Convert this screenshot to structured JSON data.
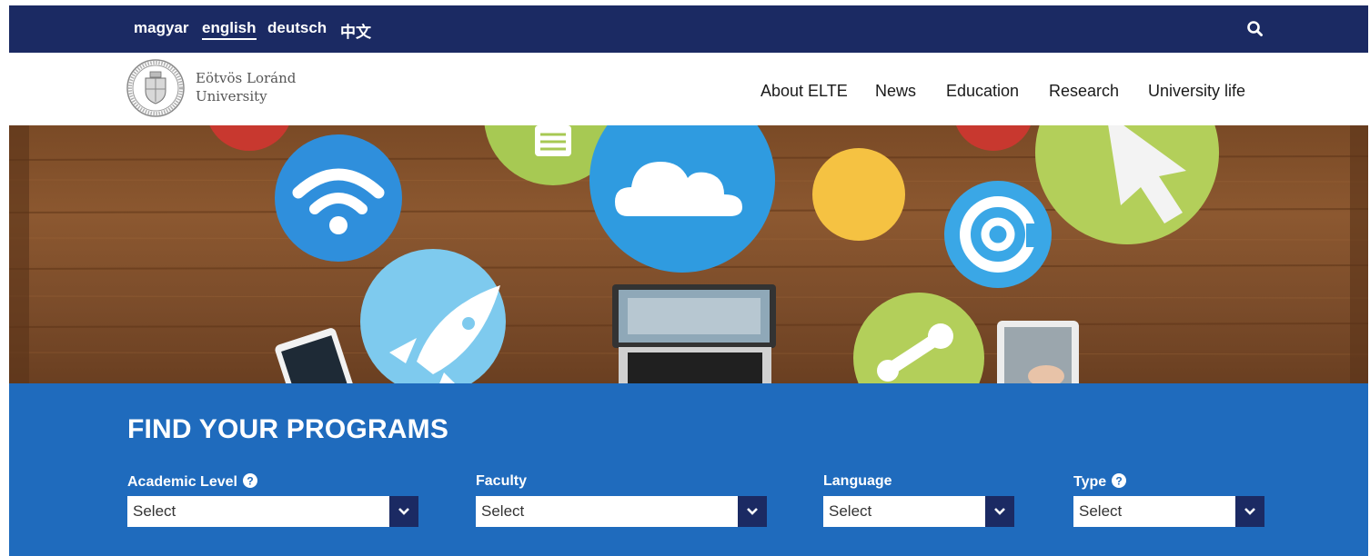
{
  "languages": [
    {
      "label": "magyar",
      "active": false
    },
    {
      "label": "english",
      "active": true
    },
    {
      "label": "deutsch",
      "active": false
    },
    {
      "label": "中文",
      "active": false
    }
  ],
  "search": {
    "icon": "search-icon"
  },
  "logo": {
    "line1": "Eötvös Loránd",
    "line2": "University"
  },
  "nav": [
    "About ELTE",
    "News",
    "Education",
    "Research",
    "University life"
  ],
  "hero": {
    "icons": [
      "wifi-icon",
      "document-icon",
      "cloud-icon",
      "at-sign-icon",
      "cursor-arrow-icon",
      "rocket-icon",
      "bone-icon"
    ]
  },
  "finder": {
    "title": "FIND YOUR PROGRAMS",
    "fields": [
      {
        "label": "Academic Level",
        "value": "Select",
        "help": true
      },
      {
        "label": "Faculty",
        "value": "Select",
        "help": false
      },
      {
        "label": "Language",
        "value": "Select",
        "help": false
      },
      {
        "label": "Type",
        "value": "Select",
        "help": true
      }
    ]
  },
  "colors": {
    "topbar": "#1b2a63",
    "finder_bg": "#1f6bbd",
    "select_arrow_bg": "#1b2a63"
  }
}
